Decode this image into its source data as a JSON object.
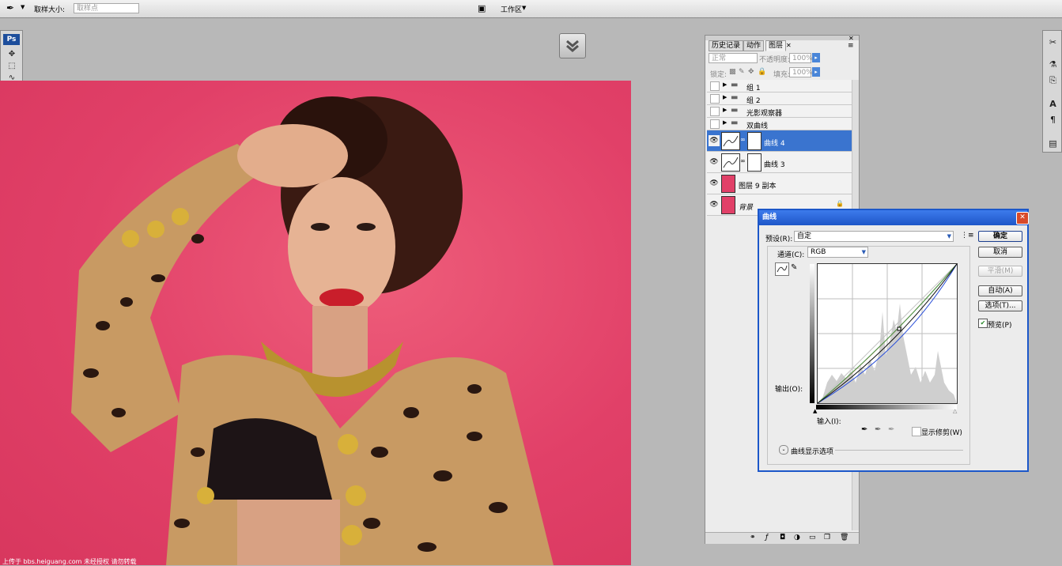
{
  "options_bar": {
    "sample_size_label": "取样大小:",
    "sample_size_value": "取样点",
    "workspace_label": "工作区"
  },
  "toolbox": {
    "logo": "Ps"
  },
  "layers_panel": {
    "tabs": [
      "历史记录",
      "动作",
      "图层"
    ],
    "blend_mode": "正常",
    "opacity_label": "不透明度:",
    "opacity_value": "100%",
    "lock_label": "锁定:",
    "fill_label": "填充:",
    "fill_value": "100%",
    "layers": [
      {
        "name": "组 1",
        "type": "group"
      },
      {
        "name": "组 2",
        "type": "group"
      },
      {
        "name": "光影观察器",
        "type": "group"
      },
      {
        "name": "双曲线",
        "type": "group"
      },
      {
        "name": "曲线 4",
        "type": "adjustment",
        "selected": true
      },
      {
        "name": "曲线 3",
        "type": "adjustment"
      },
      {
        "name": "图层 9 副本",
        "type": "pixel"
      },
      {
        "name": "背景",
        "type": "background"
      }
    ]
  },
  "curves_dialog": {
    "title": "曲线",
    "preset_label": "预设(R):",
    "preset_value": "自定",
    "channel_label": "通道(C):",
    "channel_value": "RGB",
    "output_label": "输出(O):",
    "input_label": "输入(I):",
    "show_clipping_label": "显示修剪(W)",
    "display_options_label": "曲线显示选项",
    "buttons": {
      "ok": "确定",
      "cancel": "取消",
      "smooth": "平滑(M)",
      "auto": "自动(A)",
      "options": "选项(T)..."
    },
    "preview_label": "预览(P)",
    "preview_checked": true,
    "show_clipping_checked": false
  },
  "watermark": "上传于 bbs.heiguang.com 未经授权 请勿转载",
  "colors": {
    "background_pink": "#e14068",
    "title_bar_blue": "#1e56c8",
    "selected_layer": "#3a74cf"
  }
}
